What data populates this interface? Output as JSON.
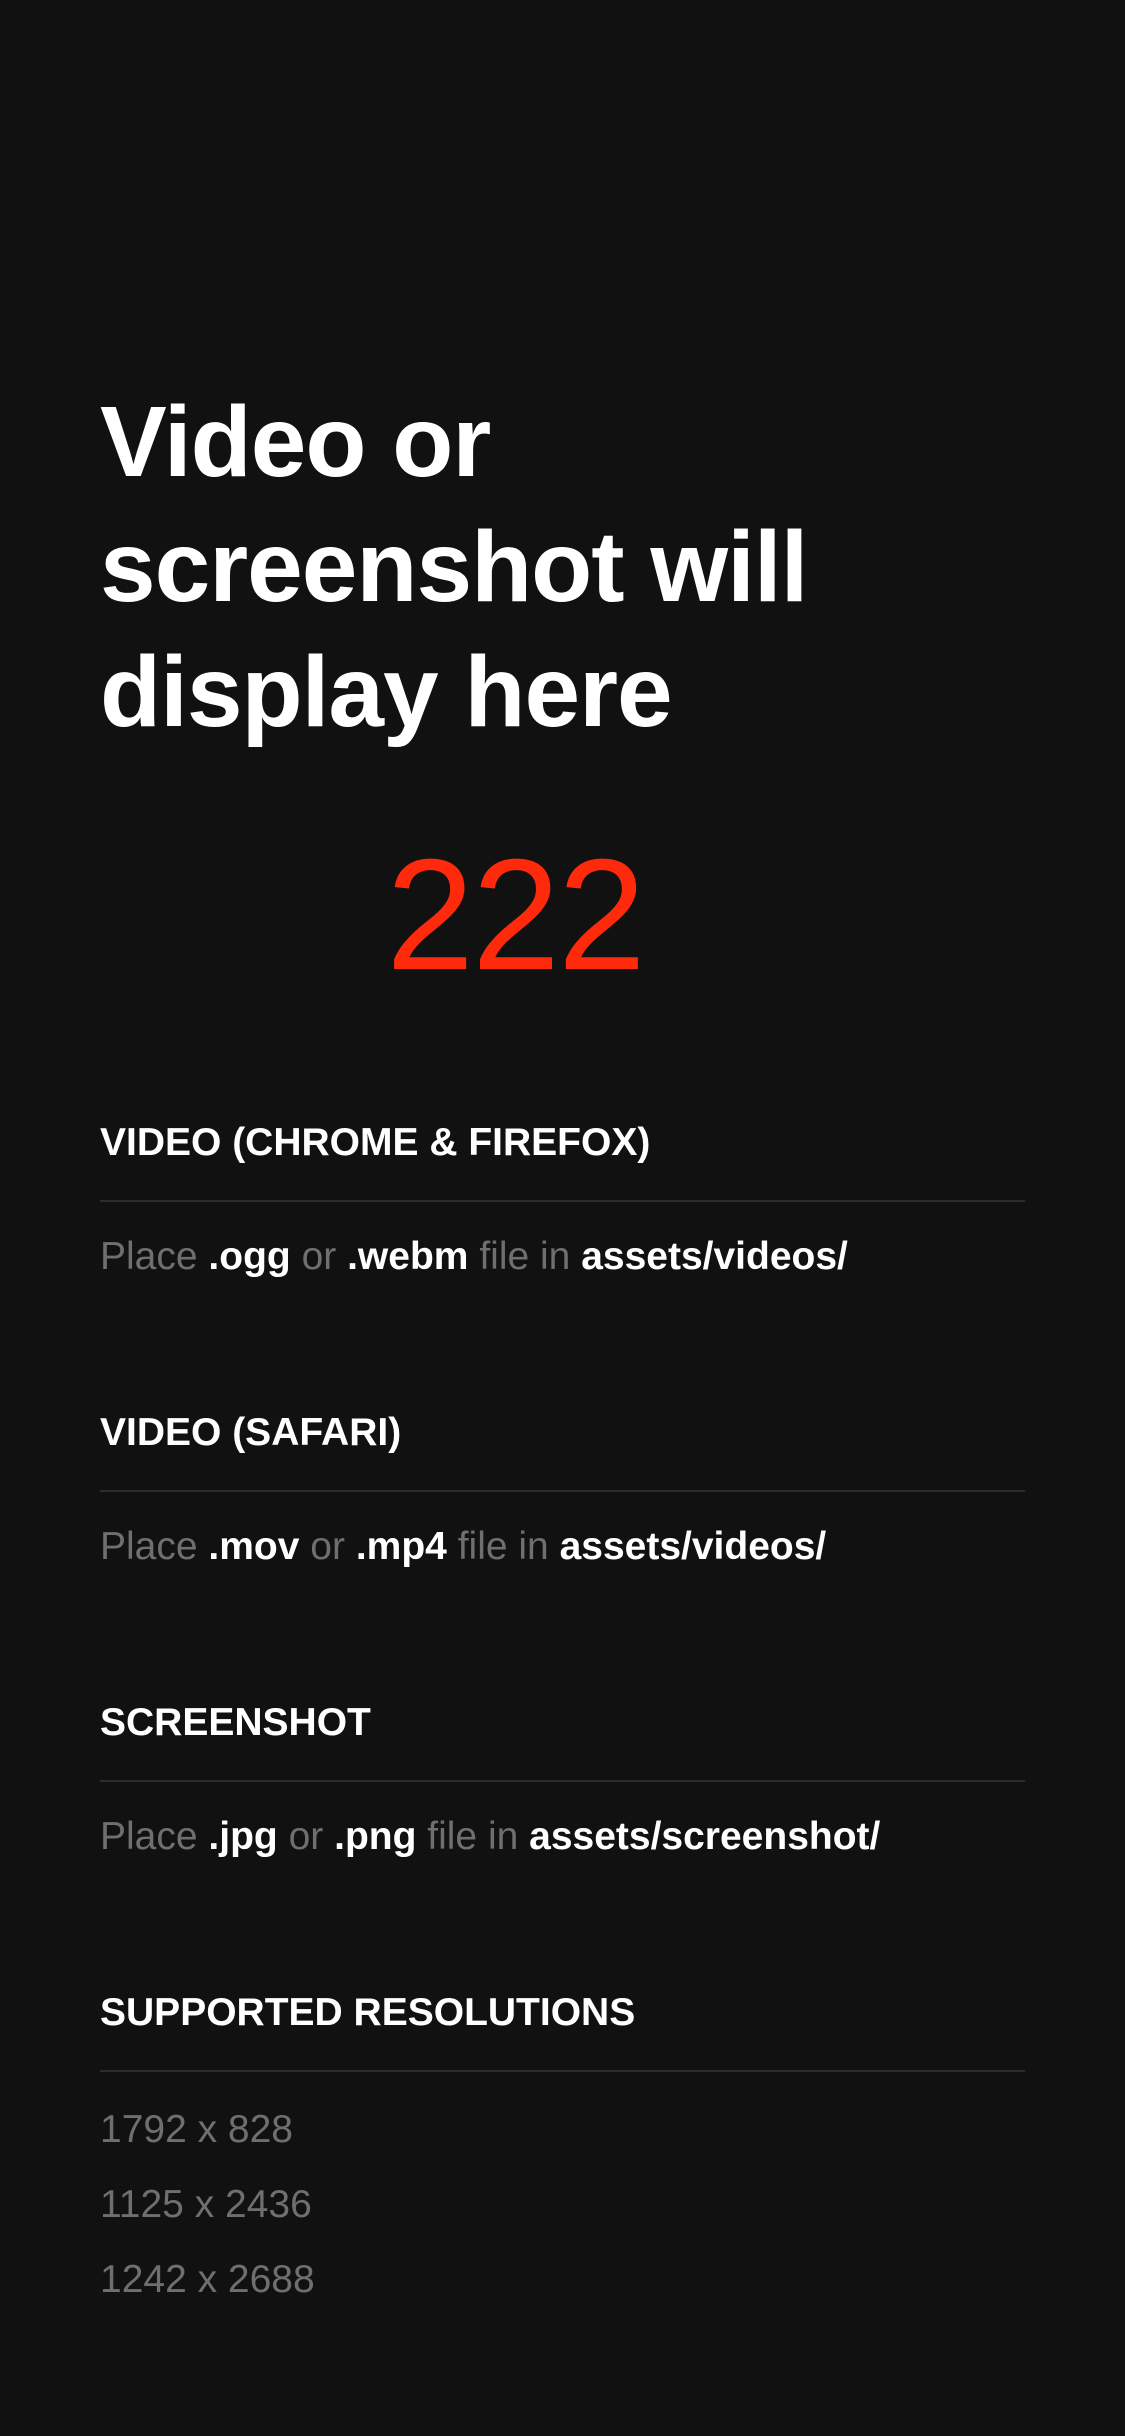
{
  "hero": {
    "title": "Video or screenshot will display here"
  },
  "counter": {
    "value": "222",
    "color": "#ff2a0c"
  },
  "sections": [
    {
      "title": "VIDEO (CHROME & FIREFOX)",
      "body": {
        "place": "Place",
        "ext1": ".ogg",
        "or": "or",
        "ext2": ".webm",
        "file_in": "file in",
        "path": "assets/videos/"
      }
    },
    {
      "title": "VIDEO (SAFARI)",
      "body": {
        "place": "Place",
        "ext1": ".mov",
        "or": "or",
        "ext2": ".mp4",
        "file_in": "file in",
        "path": "assets/videos/"
      }
    },
    {
      "title": "SCREENSHOT",
      "body": {
        "place": "Place",
        "ext1": ".jpg",
        "or": "or",
        "ext2": ".png",
        "file_in": "file in",
        "path": "assets/screenshot/"
      }
    }
  ],
  "resolutions": {
    "title": "SUPPORTED RESOLUTIONS",
    "items": [
      "1792 x 828",
      "1125 x 2436",
      "1242 x 2688"
    ]
  },
  "colors": {
    "background": "#111111",
    "text": "#ffffff",
    "muted": "#6f6f6f",
    "divider": "#2c2c2c",
    "accent": "#ff2a0c"
  }
}
